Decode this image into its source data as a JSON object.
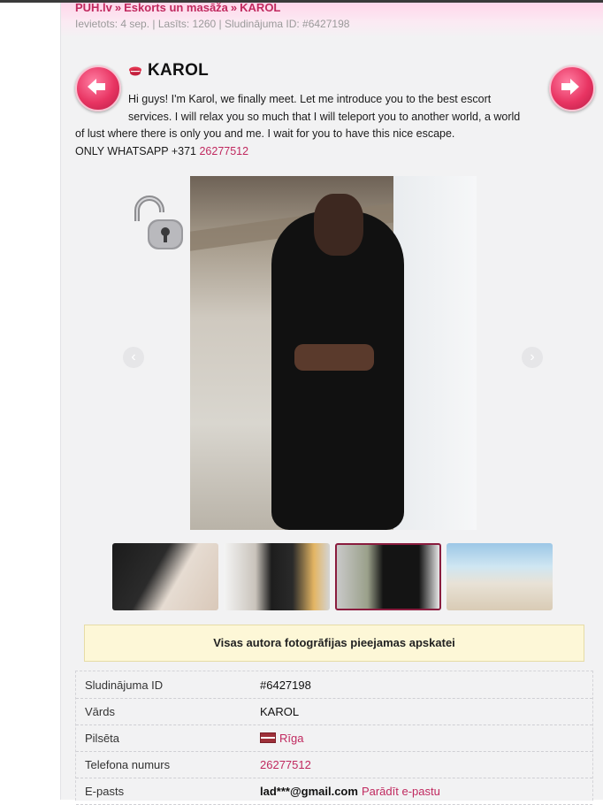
{
  "breadcrumb": {
    "site": "PUH.lv",
    "category": "Eskorts un masāža",
    "current": "KAROL",
    "separator": "»"
  },
  "meta_line": "Ievietots: 4 sep. | Lasīts: 1260 | Sludinājuma ID: #6427198",
  "listing": {
    "title": "KAROL",
    "description_line1": "Hi guys! I'm Karol, we finally meet. Let me introduce you to the best escort",
    "description_line2": "services. I will relax you so much that I will teleport you to another world, a world",
    "description_line3": "of lust where there is only you and me. I wait for you to have this nice escape.",
    "whatsapp_prefix": "ONLY WHATSAPP +371",
    "whatsapp_number": "26277512"
  },
  "gallery": {
    "prev_label": "‹",
    "next_label": "›",
    "thumbnail_count": 4,
    "selected_thumbnail": 3
  },
  "notice": "Visas autora fotogrāfijas pieejamas apskatei",
  "details": [
    {
      "label": "Sludinājuma ID",
      "value": "#6427198"
    },
    {
      "label": "Vārds",
      "value": "KAROL"
    },
    {
      "label": "Pilsēta",
      "value": "Rīga"
    },
    {
      "label": "Telefona numurs",
      "value": "26277512"
    },
    {
      "label": "E-pasts",
      "value": "lad***@gmail.com",
      "action": "Parādīt e-pastu"
    }
  ],
  "colors": {
    "accent": "#c0295f",
    "notice_bg": "#fdf7d7"
  }
}
